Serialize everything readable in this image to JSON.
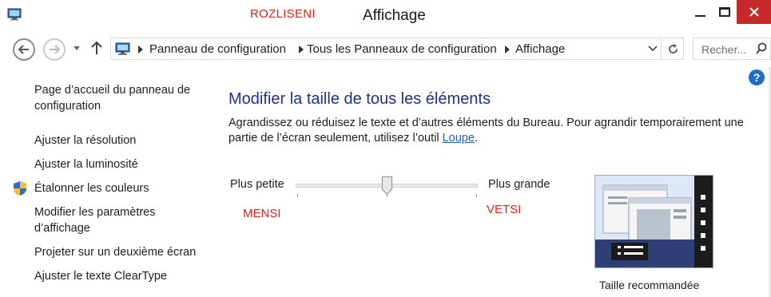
{
  "window": {
    "title": "Affichage",
    "annotation_top": "ROZLISENI"
  },
  "navigation": {
    "breadcrumbs": [
      "Panneau de configuration",
      "Tous les Panneaux de configuration",
      "Affichage"
    ],
    "search_placeholder": "Recher..."
  },
  "sidebar": {
    "items": [
      {
        "label_line1": "Page d’accueil du panneau de",
        "label_line2": "configuration"
      },
      {
        "label": "Ajuster la résolution"
      },
      {
        "label": "Ajuster la luminosité"
      },
      {
        "label": "Étalonner les couleurs",
        "icon": "shield-icon"
      },
      {
        "label_line1": "Modifier les paramètres",
        "label_line2": "d’affichage"
      },
      {
        "label": "Projeter sur un deuxième écran"
      },
      {
        "label": "Ajuster le texte ClearType"
      }
    ]
  },
  "main": {
    "heading": "Modifier la taille de tous les éléments",
    "description_line1": "Agrandissez ou réduisez le texte et d’autres éléments du Bureau. Pour agrandir temporairement une",
    "description_line2_pre": "partie de l’écran seulement, utilisez l’outil ",
    "description_link": "Loupe",
    "description_line2_post": ".",
    "slider": {
      "label_small": "Plus petite",
      "label_large": "Plus grande",
      "position_fraction": 0.5,
      "annotation_small": "MENSI",
      "annotation_large": "VETSI"
    },
    "preview_caption": "Taille recommandée"
  },
  "icons": {
    "help": "?",
    "help_color": "#1f6fc6",
    "close_color": "#c7282a",
    "annotation_color": "#e0201b",
    "heading_color": "#1e3287"
  }
}
